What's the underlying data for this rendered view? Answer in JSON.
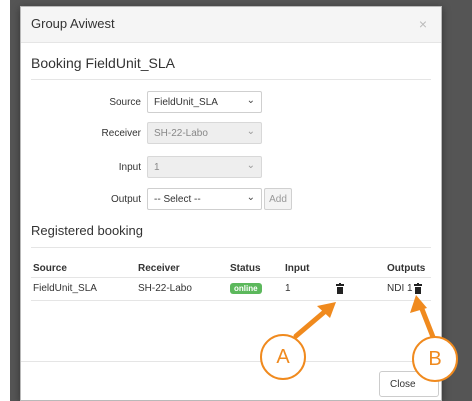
{
  "modal": {
    "title": "Group Aviwest",
    "close_symbol": "×",
    "heading": "Booking FieldUnit_SLA"
  },
  "form": {
    "source": {
      "label": "Source",
      "value": "FieldUnit_SLA",
      "disabled": false
    },
    "receiver": {
      "label": "Receiver",
      "value": "SH-22-Labo",
      "disabled": true
    },
    "input": {
      "label": "Input",
      "value": "1",
      "disabled": true
    },
    "output": {
      "label": "Output",
      "value": "-- Select --",
      "disabled": false
    },
    "add_label": "Add"
  },
  "registered": {
    "heading": "Registered booking",
    "columns": [
      "Source",
      "Receiver",
      "Status",
      "Input",
      "Outputs"
    ],
    "rows": [
      {
        "source": "FieldUnit_SLA",
        "receiver": "SH-22-Labo",
        "status": "online",
        "input": "1",
        "outputs": "NDI 1"
      }
    ]
  },
  "footer": {
    "close_label": "Close"
  },
  "annotations": {
    "a_label": "A",
    "b_label": "B",
    "color": "#f08a1e"
  },
  "icons": {
    "delete": "trash-icon",
    "dropdown": "chevron-down-icon"
  },
  "colors": {
    "status_online": "#5cb85c",
    "backdrop": "#555555"
  }
}
